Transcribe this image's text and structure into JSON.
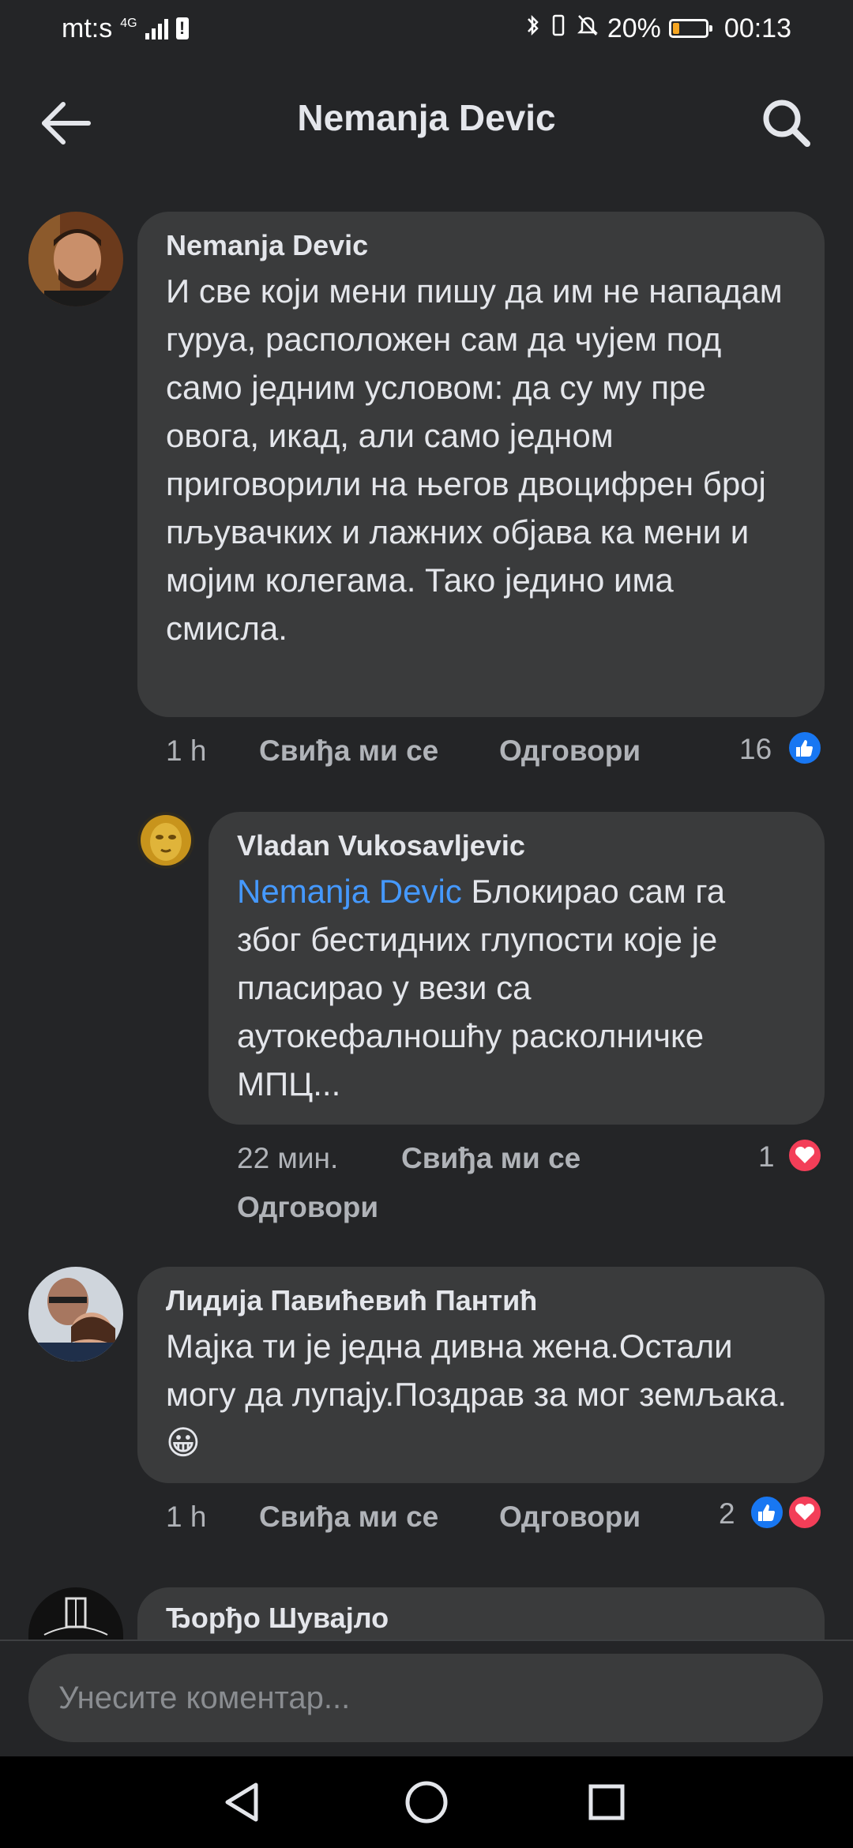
{
  "status_bar": {
    "carrier": "mt:s",
    "network": "4G",
    "battery_percent": "20%",
    "battery_level": 0.2,
    "time": "00:13"
  },
  "header": {
    "title": "Nemanja Devic",
    "back_icon": "arrow-left-icon",
    "search_icon": "search-icon"
  },
  "comments": [
    {
      "author": "Nemanja Devic",
      "text": "И све који мени пишу да им не нападам гуруа, расположен сам да чујем под само једним условом: да су му пре овога, икад, али само једном приговорили на његов двоцифрен број пљувачких и лажних објава ка мени и мојим колегама. Тако једино има смисла.",
      "time": "1 h",
      "like_label": "Свиђа ми се",
      "reply_label": "Одговори",
      "reaction_count": "16",
      "reactions": [
        "like"
      ]
    },
    {
      "author": "Vladan Vukosavljevic",
      "mention": "Nemanja Devic",
      "text": " Блокирао сам га због бестидних глупости које је пласирао у вези са аутокефалношћу расколничке МПЦ...",
      "time": "22 мин.",
      "like_label": "Свиђа ми се",
      "reply_label": "Одговори",
      "reaction_count": "1",
      "reactions": [
        "love"
      ]
    },
    {
      "author": "Лидија Павићевић Пантић",
      "text": "Мајка ти је једна дивна жена.Остали могу да лупају.Поздрав за мог земљака.",
      "emoji": "😀",
      "time": "1 h",
      "like_label": "Свиђа ми се",
      "reply_label": "Одговори",
      "reaction_count": "2",
      "reactions": [
        "like",
        "love"
      ]
    },
    {
      "author": "Ђорђо Шувајло"
    }
  ],
  "composer": {
    "placeholder": "Унесите коментар..."
  },
  "nav": {
    "back_icon": "triangle-back-icon",
    "home_icon": "circle-home-icon",
    "recents_icon": "square-recents-icon"
  },
  "colors": {
    "background": "#242527",
    "bubble": "#3a3b3c",
    "mention": "#4599ff",
    "like": "#1877f2",
    "love": "#f33e58"
  }
}
